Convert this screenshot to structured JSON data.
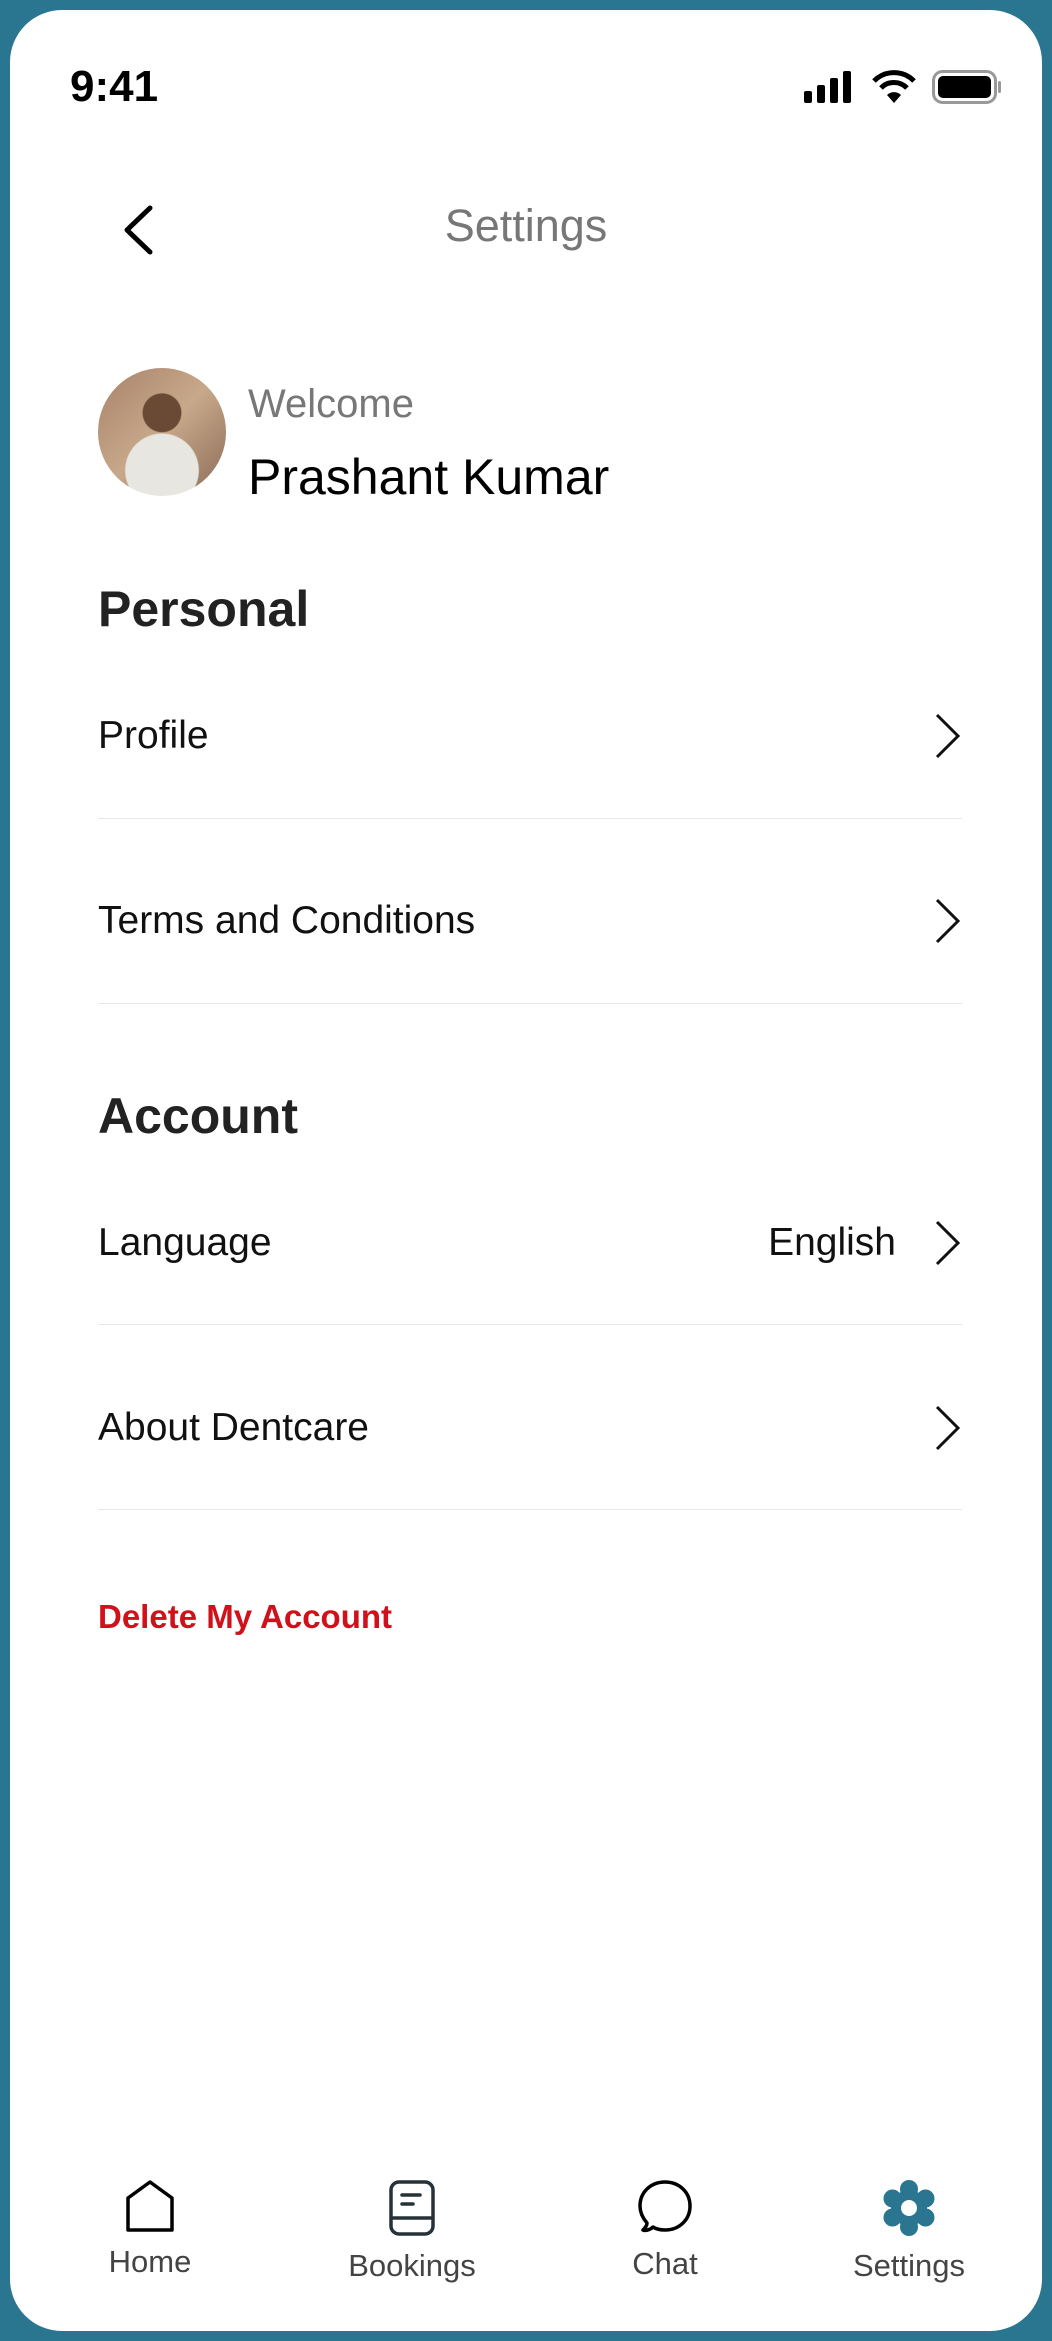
{
  "status_bar": {
    "time": "9:41",
    "icons": [
      "signal-icon",
      "wifi-icon",
      "battery-icon"
    ]
  },
  "header": {
    "title": "Settings",
    "back_icon": "chevron-left-icon"
  },
  "user": {
    "greeting": "Welcome",
    "name": "Prashant Kumar"
  },
  "sections": [
    {
      "title": "Personal",
      "items": [
        {
          "label": "Profile",
          "value": ""
        },
        {
          "label": "Terms and Conditions",
          "value": ""
        }
      ]
    },
    {
      "title": "Account",
      "items": [
        {
          "label": "Language",
          "value": "English"
        },
        {
          "label": "About Dentcare",
          "value": ""
        }
      ]
    }
  ],
  "delete_label": "Delete My Account",
  "nav": [
    {
      "label": "Home",
      "icon": "home-icon"
    },
    {
      "label": "Bookings",
      "icon": "bookings-icon"
    },
    {
      "label": "Chat",
      "icon": "chat-icon"
    },
    {
      "label": "Settings",
      "icon": "gear-icon",
      "active": true
    }
  ],
  "colors": {
    "accent": "#2a7590",
    "danger": "#d0111b"
  }
}
